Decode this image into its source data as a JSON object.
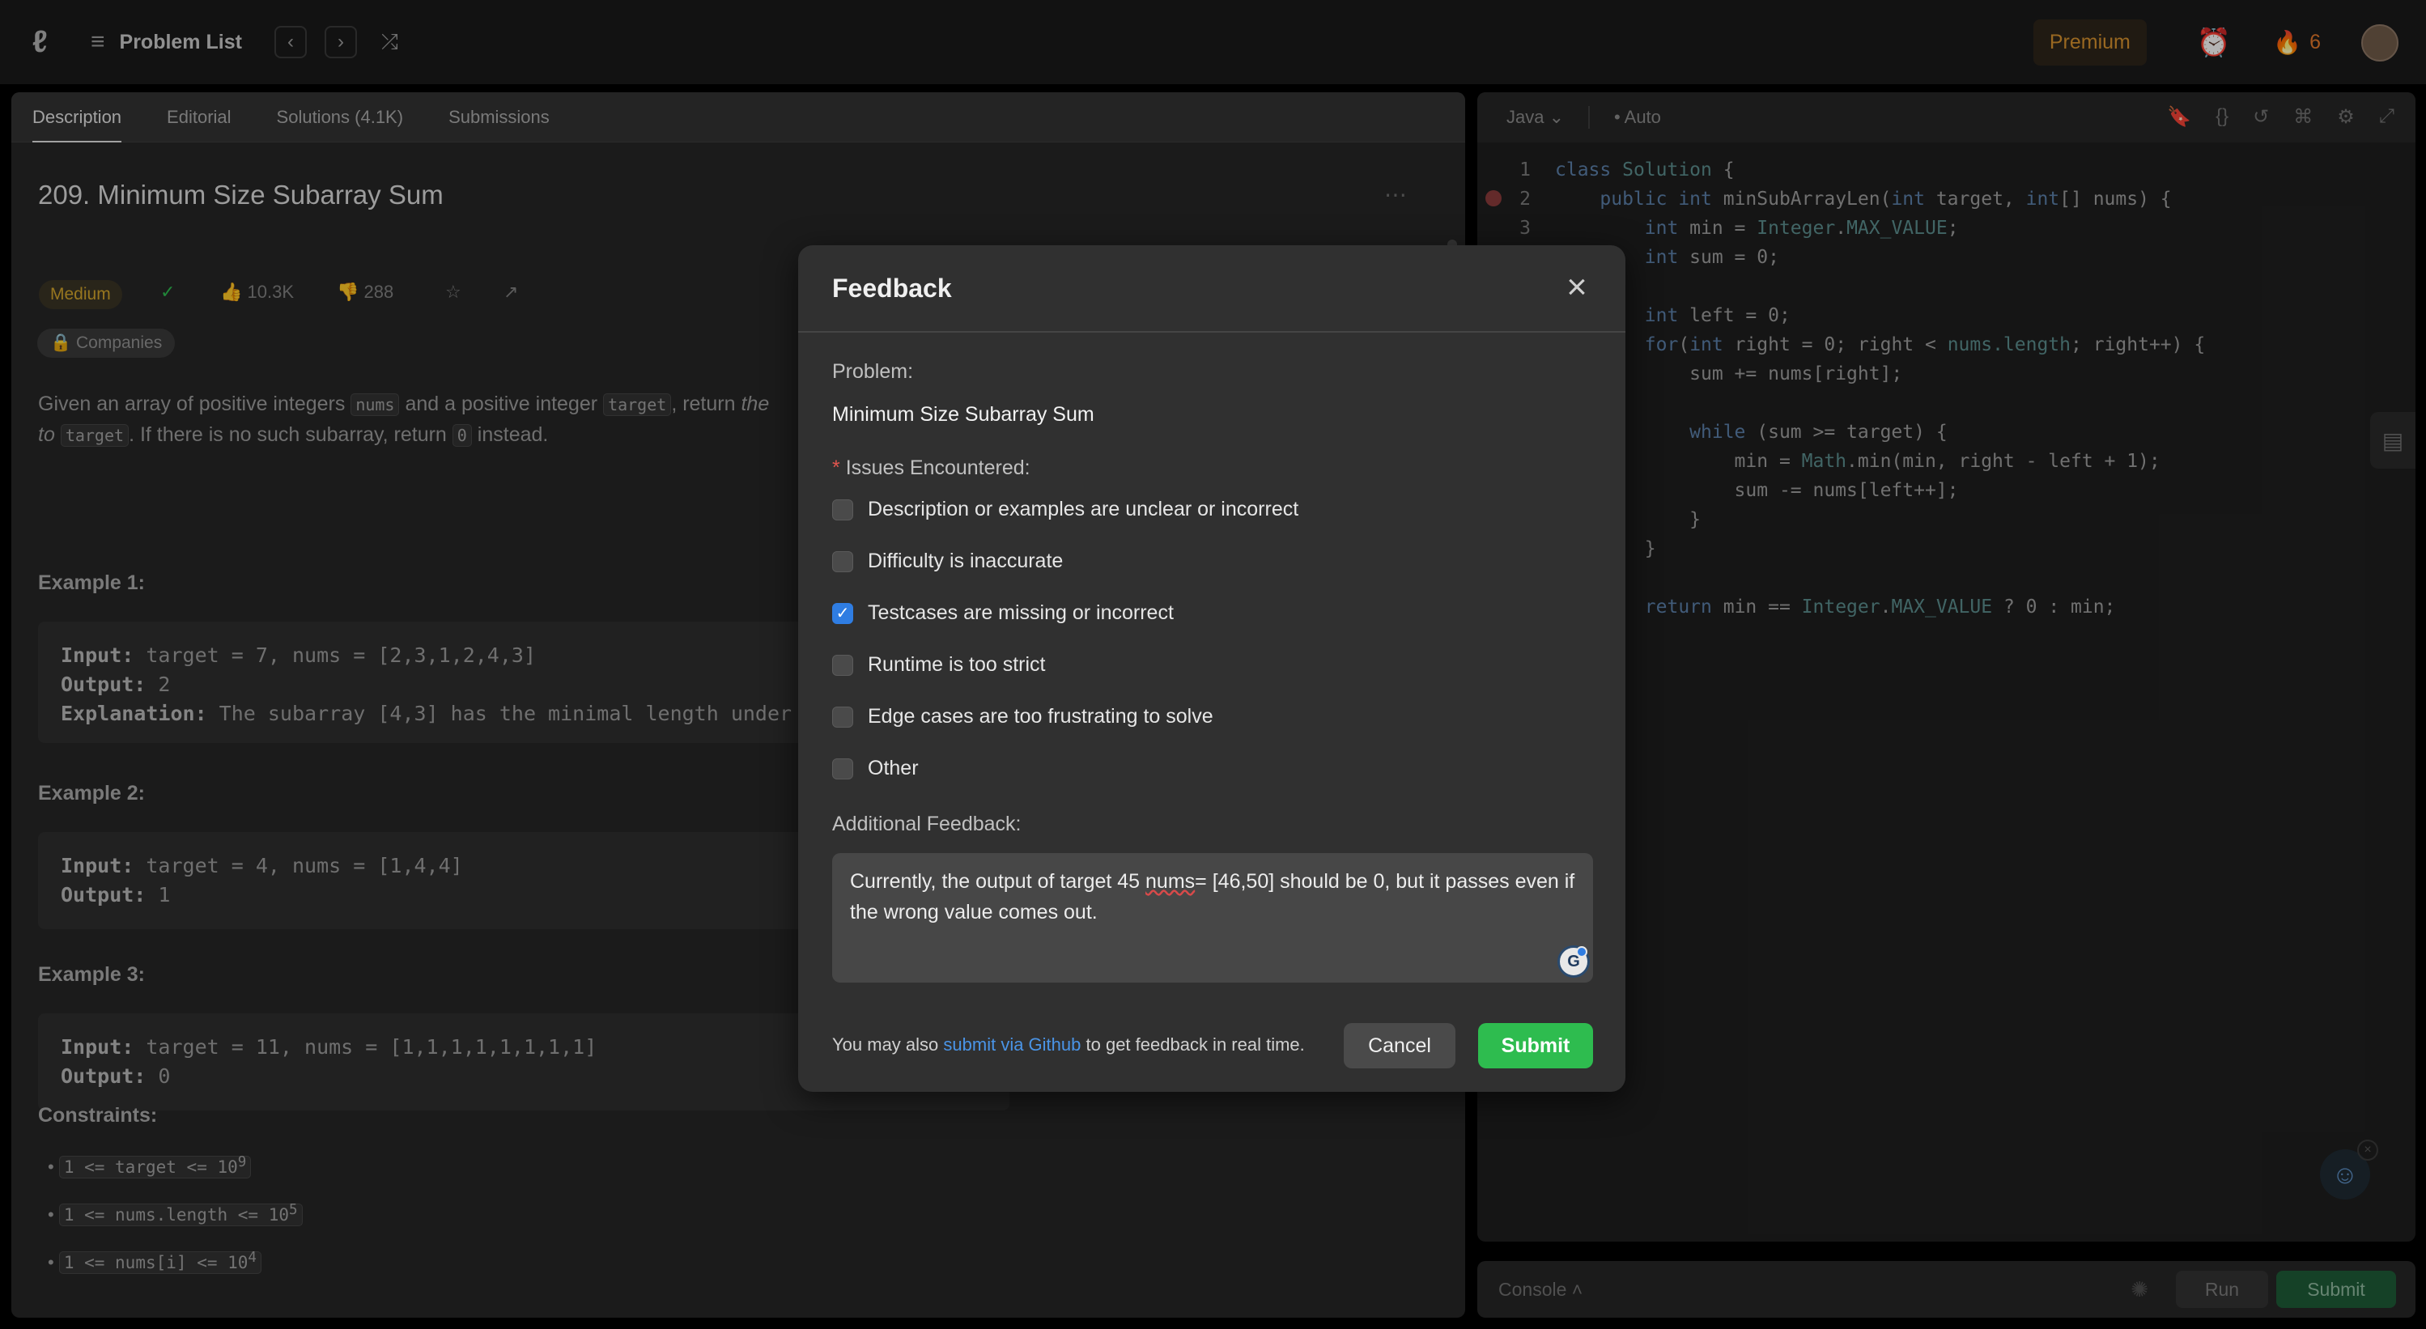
{
  "nav": {
    "title": "Problem List",
    "premium": "Premium",
    "streak": "6"
  },
  "left": {
    "tabs": [
      "Description",
      "Editorial",
      "Solutions (4.1K)",
      "Submissions"
    ],
    "problem_title": "209. Minimum Size Subarray Sum",
    "difficulty": "Medium",
    "likes": "10.3K",
    "dislikes": "288",
    "companies": "Companies",
    "desc": {
      "p1": "Given an array of positive integers",
      "c1": "nums",
      "p2": "and a positive integer",
      "c2": "target",
      "p3": ", return",
      "p4": "the",
      "p5": "to",
      "c3": "target",
      "p6": ". If there is no such subarray, return",
      "c4": "0",
      "p7": "instead."
    },
    "examples": [
      {
        "heading": "Example 1:",
        "input_label": "Input:",
        "input": " target = 7, nums = [2,3,1,2,4,3]",
        "output_label": "Output:",
        "output": " 2",
        "expl_label": "Explanation:",
        "expl": " The subarray [4,3] has the minimal length under"
      },
      {
        "heading": "Example 2:",
        "input_label": "Input:",
        "input": " target = 4, nums = [1,4,4]",
        "output_label": "Output:",
        "output": " 1"
      },
      {
        "heading": "Example 3:",
        "input_label": "Input:",
        "input": " target = 11, nums = [1,1,1,1,1,1,1,1]",
        "output_label": "Output:",
        "output": " 0"
      }
    ],
    "constraints_heading": "Constraints:",
    "constraints": [
      {
        "text": "1 <= target <= 10",
        "sup": "9"
      },
      {
        "text": "1 <= nums.length <= 10",
        "sup": "5"
      },
      {
        "text": "1 <= nums[i] <= 10",
        "sup": "4"
      }
    ]
  },
  "editor": {
    "language": "Java",
    "mode": "Auto",
    "code_lines": [
      {
        "n": "1",
        "parts": [
          [
            "kw",
            "class "
          ],
          [
            "ty",
            "Solution "
          ],
          [
            "tx",
            "{"
          ]
        ]
      },
      {
        "n": "2",
        "parts": [
          [
            "tx",
            "    "
          ],
          [
            "kw",
            "public int "
          ],
          [
            "tx",
            "minSubArrayLen("
          ],
          [
            "kw",
            "int "
          ],
          [
            "tx",
            "target, "
          ],
          [
            "kw",
            "int"
          ],
          [
            "tx",
            "[] nums) {"
          ]
        ]
      },
      {
        "n": "3",
        "parts": [
          [
            "tx",
            "        "
          ],
          [
            "kw",
            "int "
          ],
          [
            "tx",
            "min = "
          ],
          [
            "ty",
            "Integer"
          ],
          [
            "tx",
            "."
          ],
          [
            "ty",
            "MAX_VALUE"
          ],
          [
            "tx",
            ";"
          ]
        ]
      },
      {
        "n": "",
        "parts": [
          [
            "tx",
            "        "
          ],
          [
            "kw",
            "int "
          ],
          [
            "tx",
            "sum = 0;"
          ]
        ]
      },
      {
        "n": "",
        "parts": [
          [
            "tx",
            ""
          ]
        ]
      },
      {
        "n": "",
        "parts": [
          [
            "tx",
            "        "
          ],
          [
            "kw",
            "int "
          ],
          [
            "tx",
            "left = 0;"
          ]
        ]
      },
      {
        "n": "",
        "parts": [
          [
            "tx",
            "        "
          ],
          [
            "kw",
            "for"
          ],
          [
            "tx",
            "("
          ],
          [
            "kw",
            "int "
          ],
          [
            "tx",
            "right = 0; right < "
          ],
          [
            "ty",
            "nums.length"
          ],
          [
            "tx",
            "; right++) {"
          ]
        ]
      },
      {
        "n": "",
        "parts": [
          [
            "tx",
            "            sum += nums[right];"
          ]
        ]
      },
      {
        "n": "",
        "parts": [
          [
            "tx",
            ""
          ]
        ]
      },
      {
        "n": "",
        "parts": [
          [
            "tx",
            "            "
          ],
          [
            "kw",
            "while "
          ],
          [
            "tx",
            "(sum >= target) {"
          ]
        ]
      },
      {
        "n": "",
        "parts": [
          [
            "tx",
            "                min = "
          ],
          [
            "ty",
            "Math"
          ],
          [
            "tx",
            ".min(min, right - left + 1);"
          ]
        ]
      },
      {
        "n": "",
        "parts": [
          [
            "tx",
            "                sum -= nums[left++];"
          ]
        ]
      },
      {
        "n": "",
        "parts": [
          [
            "tx",
            "            }"
          ]
        ]
      },
      {
        "n": "",
        "parts": [
          [
            "tx",
            "        }"
          ]
        ]
      },
      {
        "n": "",
        "parts": [
          [
            "tx",
            ""
          ]
        ]
      },
      {
        "n": "",
        "parts": [
          [
            "tx",
            "        "
          ],
          [
            "kw",
            "return "
          ],
          [
            "tx",
            "min == "
          ],
          [
            "ty",
            "Integer"
          ],
          [
            "tx",
            "."
          ],
          [
            "ty",
            "MAX_VALUE "
          ],
          [
            "tx",
            "? 0 : min;"
          ]
        ]
      }
    ],
    "console": "Console",
    "run": "Run",
    "submit": "Submit"
  },
  "modal": {
    "title": "Feedback",
    "problem_label": "Problem:",
    "problem_name": "Minimum Size Subarray Sum",
    "required_mark": "*",
    "issues_label": "Issues Encountered:",
    "issues": [
      {
        "label": "Description or examples are unclear or incorrect",
        "checked": false
      },
      {
        "label": "Difficulty is inaccurate",
        "checked": false
      },
      {
        "label": "Testcases are missing or incorrect",
        "checked": true
      },
      {
        "label": "Runtime is too strict",
        "checked": false
      },
      {
        "label": "Edge cases are too frustrating to solve",
        "checked": false
      },
      {
        "label": "Other",
        "checked": false
      }
    ],
    "additional_label": "Additional Feedback:",
    "feedback_text_a": "Currently, the output of target 45 ",
    "feedback_text_misspelled": "nums",
    "feedback_text_b": "= [46,50] should be 0, but it passes even if the wrong value comes out.",
    "footer_pre": "You may also",
    "footer_link": "submit via Github",
    "footer_post": "to get feedback in real time.",
    "cancel": "Cancel",
    "submit": "Submit"
  },
  "colors": {
    "accent_green": "#2ebc4f",
    "link_blue": "#4a94e6",
    "medium": "#d2a42c",
    "premium": "#d4902f"
  }
}
